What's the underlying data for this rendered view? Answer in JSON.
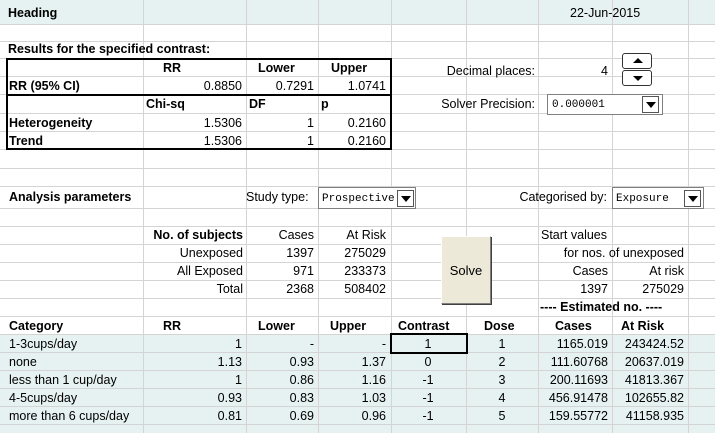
{
  "header": {
    "title": "Heading",
    "date": "22-Jun-2015"
  },
  "results": {
    "section_title": "Results for the specified contrast:",
    "headers": [
      "RR",
      "Lower",
      "Upper"
    ],
    "rr_row": {
      "label": "RR (95% CI)",
      "rr": "0.8850",
      "lower": "0.7291",
      "upper": "1.0741"
    },
    "test_headers": [
      "Chi-sq",
      "DF",
      "p"
    ],
    "heterogeneity": {
      "label": "Heterogeneity",
      "chisq": "1.5306",
      "df": "1",
      "p": "0.2160"
    },
    "trend": {
      "label": "Trend",
      "chisq": "1.5306",
      "df": "1",
      "p": "0.2160"
    }
  },
  "settings": {
    "decimal_label": "Decimal places:",
    "decimal_value": "4",
    "solver_label": "Solver Precision:",
    "solver_value": "0.000001"
  },
  "analysis": {
    "title": "Analysis parameters",
    "study_type_label": "Study type:",
    "study_type_value": "Prospective",
    "categorised_label": "Categorised by:",
    "categorised_value": "Exposure"
  },
  "subjects": {
    "headers": [
      "No. of subjects",
      "Cases",
      "At Risk"
    ],
    "rows": [
      {
        "label": "Unexposed",
        "cases": "1397",
        "at_risk": "275029"
      },
      {
        "label": "All Exposed",
        "cases": "971",
        "at_risk": "233373"
      },
      {
        "label": "Total",
        "cases": "2368",
        "at_risk": "508402"
      }
    ]
  },
  "solve_label": "Solve",
  "start_values": {
    "line1": "Start values",
    "line2": "for nos. of unexposed",
    "cases_header": "Cases",
    "at_risk_header": "At risk",
    "cases": "1397",
    "at_risk": "275029",
    "estimated_label": "---- Estimated no. ----"
  },
  "table": {
    "headers": [
      "Category",
      "RR",
      "Lower",
      "Upper",
      "Contrast",
      "Dose",
      "Cases",
      "At Risk"
    ],
    "rows": [
      {
        "category": "1-3cups/day",
        "rr": "1",
        "lower": "-",
        "upper": "-",
        "contrast": "1",
        "dose": "1",
        "cases": "1165.019",
        "at_risk": "243424.52"
      },
      {
        "category": "none",
        "rr": "1.13",
        "lower": "0.93",
        "upper": "1.37",
        "contrast": "0",
        "dose": "2",
        "cases": "111.60768",
        "at_risk": "20637.019"
      },
      {
        "category": "less than 1 cup/day",
        "rr": "1",
        "lower": "0.86",
        "upper": "1.16",
        "contrast": "-1",
        "dose": "3",
        "cases": "200.11693",
        "at_risk": "41813.367"
      },
      {
        "category": "4-5cups/day",
        "rr": "0.93",
        "lower": "0.83",
        "upper": "1.03",
        "contrast": "-1",
        "dose": "4",
        "cases": "456.91478",
        "at_risk": "102655.82"
      },
      {
        "category": "more than 6 cups/day",
        "rr": "0.81",
        "lower": "0.69",
        "upper": "0.96",
        "contrast": "-1",
        "dose": "5",
        "cases": "159.55772",
        "at_risk": "41158.935"
      }
    ]
  }
}
